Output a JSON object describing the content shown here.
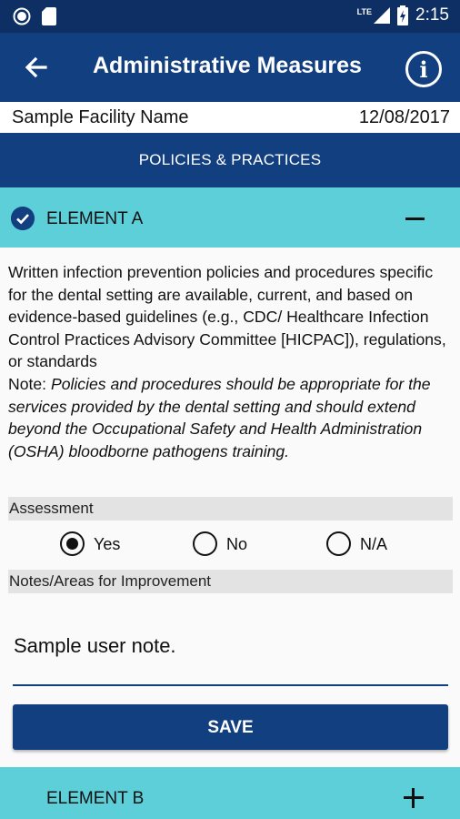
{
  "status_bar": {
    "time": "2:15",
    "network": "LTE",
    "icons": [
      "record-icon",
      "sd-card-icon",
      "signal-icon",
      "battery-charging-icon"
    ]
  },
  "app_bar": {
    "title": "Administrative Measures",
    "back_icon": "arrow-back-icon",
    "info_icon": "info-icon",
    "info_glyph": "i"
  },
  "facility": {
    "name": "Sample Facility Name",
    "date": "12/08/2017"
  },
  "section": {
    "title": "POLICIES & PRACTICES"
  },
  "element_a": {
    "label": "ELEMENT A",
    "completed": true,
    "expanded": true,
    "description": "Written infection prevention policies and procedures specific for the dental setting are available, current, and based on evidence-based guidelines (e.g., CDC/ Healthcare Infection Control Practices Advisory Committee [HICPAC]), regulations, or standards",
    "note_label": "Note: ",
    "note_text": "Policies and procedures should be appropriate for the services provided by the dental setting and should extend beyond the Occupational Safety and Health Administration (OSHA) bloodborne pathogens training."
  },
  "assessment": {
    "label": "Assessment",
    "options": [
      "Yes",
      "No",
      "N/A"
    ],
    "selected": "Yes"
  },
  "notes": {
    "label": "Notes/Areas for Improvement",
    "value": "Sample user note."
  },
  "save_label": "SAVE",
  "element_b": {
    "label": "ELEMENT B",
    "expanded": false
  },
  "colors": {
    "status_bar": "#0e2f63",
    "primary": "#123f80",
    "accent_teal": "#5dcfd8",
    "band_gray": "#e3e3e3"
  }
}
